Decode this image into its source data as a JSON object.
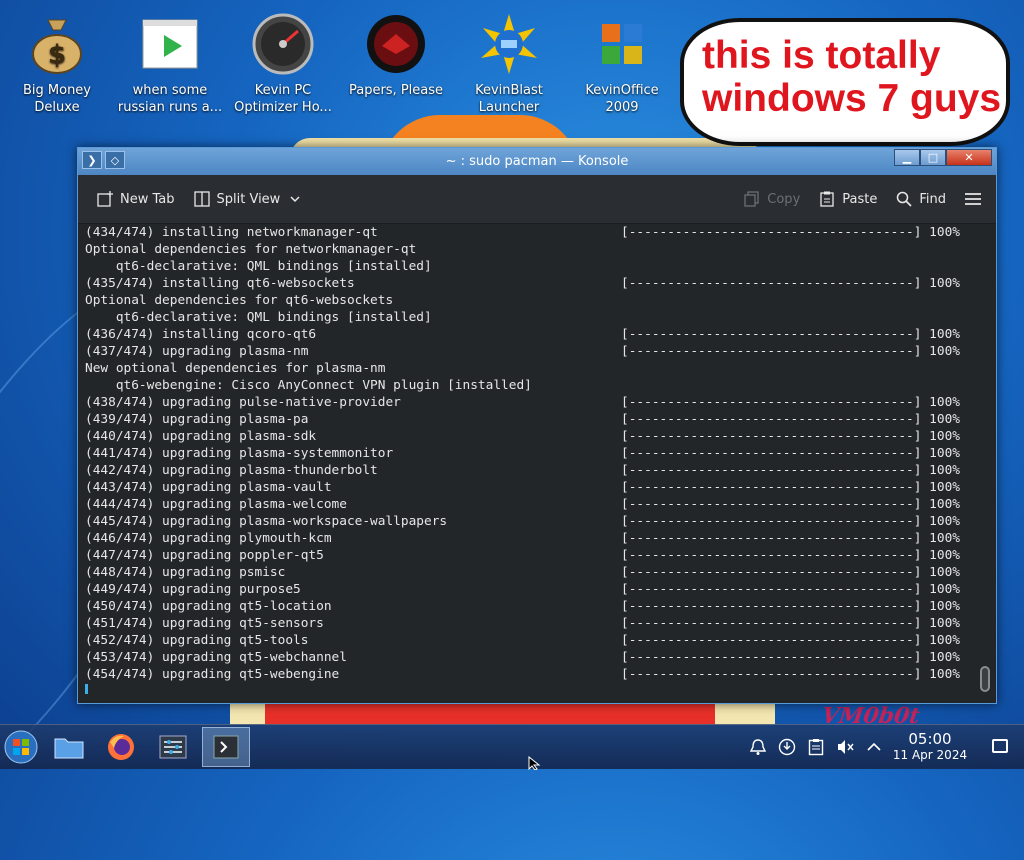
{
  "desktop": {
    "icons": [
      {
        "label": "Big Money\nDeluxe",
        "icon": "money-bag-icon"
      },
      {
        "label": "when some\nrussian runs a...",
        "icon": "video-play-icon"
      },
      {
        "label": "Kevin PC\nOptimizer Ho...",
        "icon": "speedometer-icon"
      },
      {
        "label": "Papers, Please",
        "icon": "papers-please-seal-icon"
      },
      {
        "label": "KevinBlast\nLauncher",
        "icon": "rocket-burst-icon"
      },
      {
        "label": "KevinOffice\n2009",
        "icon": "office-logo-icon"
      }
    ],
    "bubble_text": "this is totally\nwindows 7 guys",
    "watermark": "VM0b0t"
  },
  "window": {
    "title": "~ : sudo pacman — Konsole",
    "toolbar": {
      "new_tab": "New Tab",
      "split_view": "Split View",
      "copy": "Copy",
      "paste": "Paste",
      "find": "Find"
    },
    "lines": [
      {
        "text": "(434/474) installing networkmanager-qt",
        "bar": "[-------------------------------------] 100%"
      },
      {
        "text": "Optional dependencies for networkmanager-qt",
        "bar": ""
      },
      {
        "text": "    qt6-declarative: QML bindings [installed]",
        "bar": ""
      },
      {
        "text": "(435/474) installing qt6-websockets",
        "bar": "[-------------------------------------] 100%"
      },
      {
        "text": "Optional dependencies for qt6-websockets",
        "bar": ""
      },
      {
        "text": "    qt6-declarative: QML bindings [installed]",
        "bar": ""
      },
      {
        "text": "(436/474) installing qcoro-qt6",
        "bar": "[-------------------------------------] 100%"
      },
      {
        "text": "(437/474) upgrading plasma-nm",
        "bar": "[-------------------------------------] 100%"
      },
      {
        "text": "New optional dependencies for plasma-nm",
        "bar": ""
      },
      {
        "text": "    qt6-webengine: Cisco AnyConnect VPN plugin [installed]",
        "bar": ""
      },
      {
        "text": "(438/474) upgrading pulse-native-provider",
        "bar": "[-------------------------------------] 100%"
      },
      {
        "text": "(439/474) upgrading plasma-pa",
        "bar": "[-------------------------------------] 100%"
      },
      {
        "text": "(440/474) upgrading plasma-sdk",
        "bar": "[-------------------------------------] 100%"
      },
      {
        "text": "(441/474) upgrading plasma-systemmonitor",
        "bar": "[-------------------------------------] 100%"
      },
      {
        "text": "(442/474) upgrading plasma-thunderbolt",
        "bar": "[-------------------------------------] 100%"
      },
      {
        "text": "(443/474) upgrading plasma-vault",
        "bar": "[-------------------------------------] 100%"
      },
      {
        "text": "(444/474) upgrading plasma-welcome",
        "bar": "[-------------------------------------] 100%"
      },
      {
        "text": "(445/474) upgrading plasma-workspace-wallpapers",
        "bar": "[-------------------------------------] 100%"
      },
      {
        "text": "(446/474) upgrading plymouth-kcm",
        "bar": "[-------------------------------------] 100%"
      },
      {
        "text": "(447/474) upgrading poppler-qt5",
        "bar": "[-------------------------------------] 100%"
      },
      {
        "text": "(448/474) upgrading psmisc",
        "bar": "[-------------------------------------] 100%"
      },
      {
        "text": "(449/474) upgrading purpose5",
        "bar": "[-------------------------------------] 100%"
      },
      {
        "text": "(450/474) upgrading qt5-location",
        "bar": "[-------------------------------------] 100%"
      },
      {
        "text": "(451/474) upgrading qt5-sensors",
        "bar": "[-------------------------------------] 100%"
      },
      {
        "text": "(452/474) upgrading qt5-tools",
        "bar": "[-------------------------------------] 100%"
      },
      {
        "text": "(453/474) upgrading qt5-webchannel",
        "bar": "[-------------------------------------] 100%"
      },
      {
        "text": "(454/474) upgrading qt5-webengine",
        "bar": "[-------------------------------------] 100%"
      }
    ]
  },
  "taskbar": {
    "apps": [
      "start-orb-icon",
      "file-manager-icon",
      "firefox-icon",
      "system-settings-icon",
      "konsole-icon"
    ],
    "tray": [
      "notifications-icon",
      "updates-icon",
      "clipboard-icon",
      "volume-muted-icon",
      "expand-tray-icon"
    ],
    "time": "05:00",
    "date": "11 Apr 2024"
  },
  "colors": {
    "accent": "#3daee9",
    "titlebar": "#5b93cf",
    "terminal_bg": "#232629",
    "bubble_text": "#e0161f"
  }
}
